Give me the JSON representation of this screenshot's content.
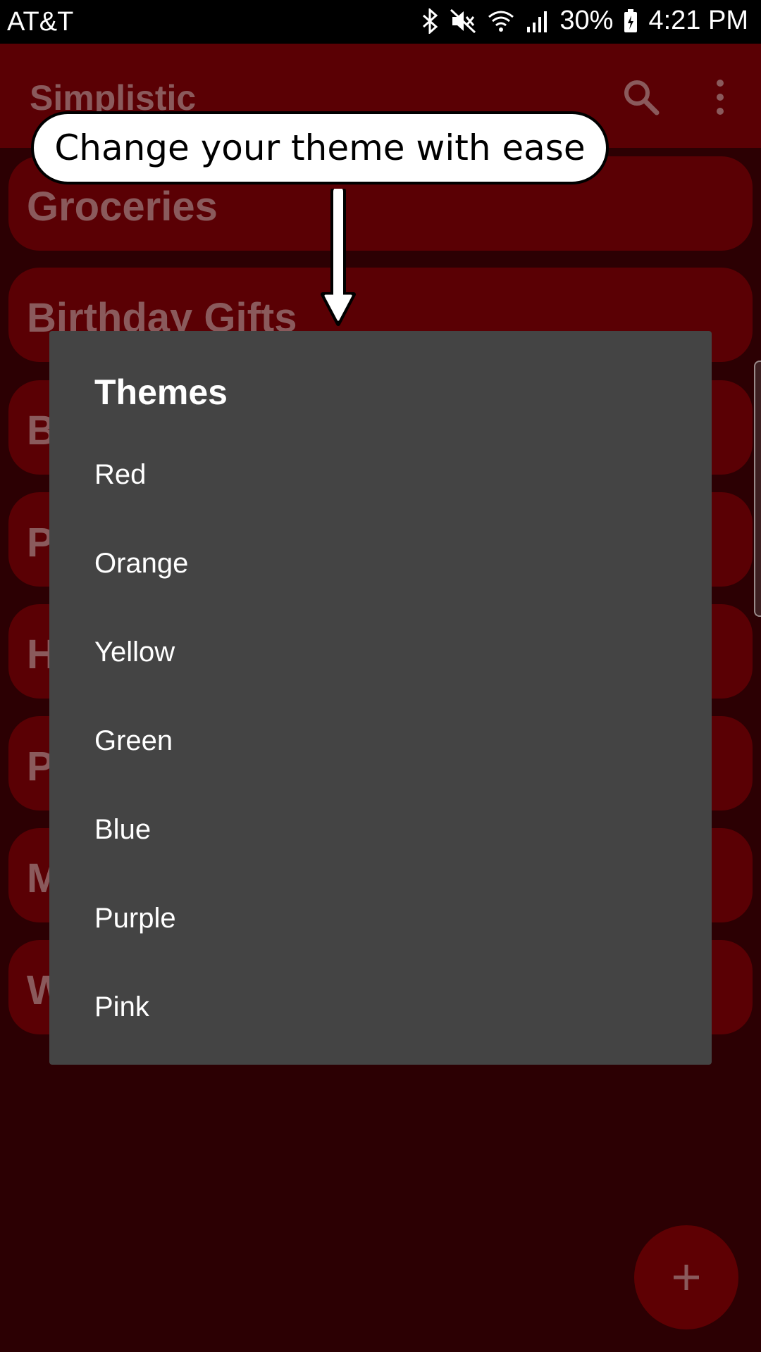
{
  "status_bar": {
    "carrier": "AT&T",
    "battery": "30%",
    "time": "4:21 PM"
  },
  "app_bar": {
    "title": "Simplistic"
  },
  "lists": [
    {
      "label": "Groceries"
    },
    {
      "label": "Birthday Gifts"
    },
    {
      "label": "B"
    },
    {
      "label": "P"
    },
    {
      "label": "H"
    },
    {
      "label": "P"
    },
    {
      "label": "M"
    },
    {
      "label": "W"
    }
  ],
  "callout": {
    "text": "Change your theme with ease"
  },
  "dialog": {
    "title": "Themes",
    "options": [
      "Red",
      "Orange",
      "Yellow",
      "Green",
      "Blue",
      "Purple",
      "Pink"
    ]
  },
  "fab": {
    "symbol": "+"
  },
  "colors": {
    "app_bar": "#5a0004",
    "background": "#2c0003",
    "dialog": "#444444"
  }
}
